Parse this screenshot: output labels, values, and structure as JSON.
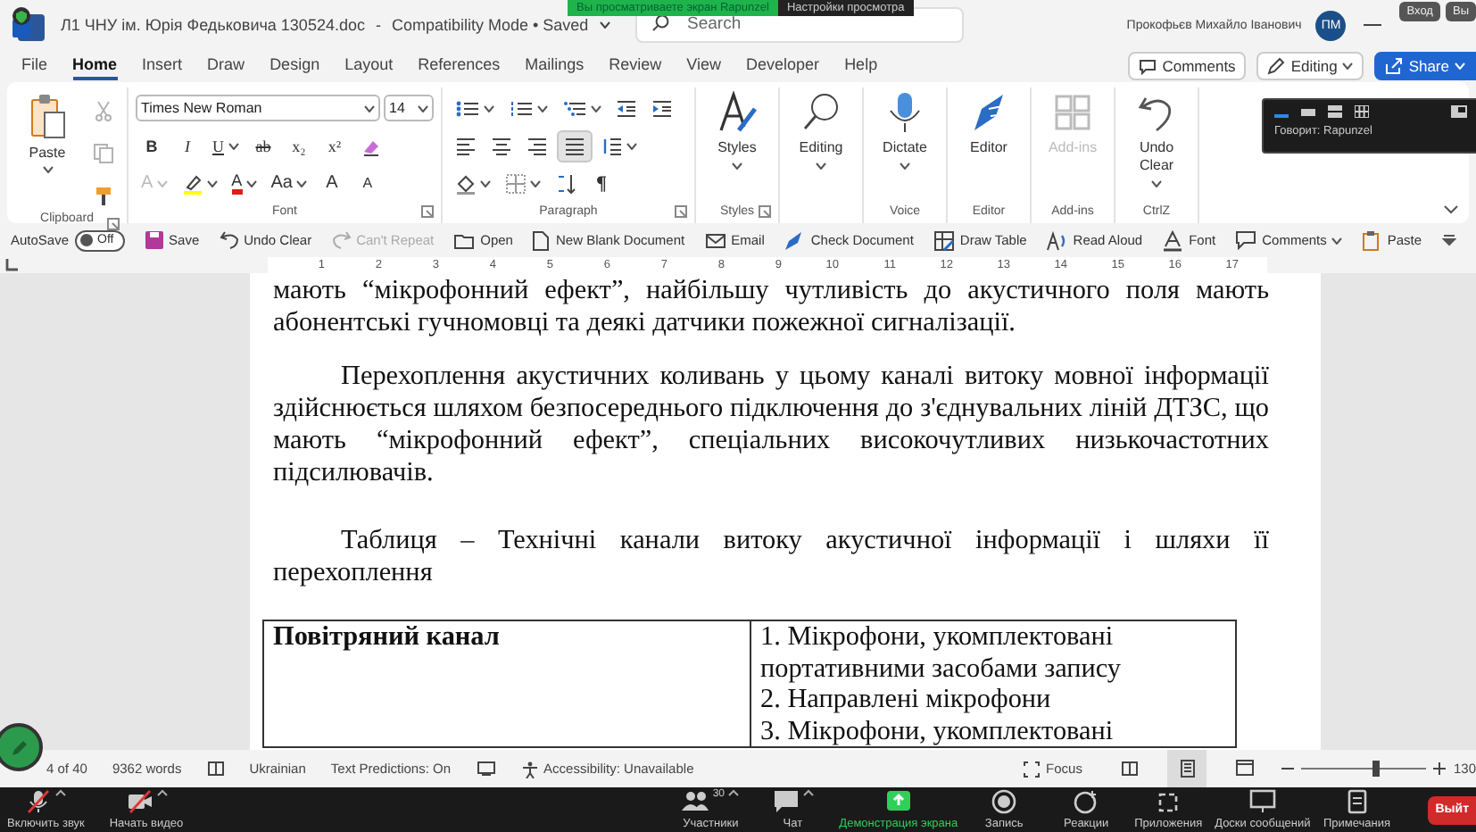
{
  "viewer_banner": {
    "message": "Вы просматриваете экран Rapunzel",
    "settings": "Настройки просмотра"
  },
  "title_bar": {
    "document_title": "Л1 ЧНУ ім. Юрія Федьковича 130524.doc",
    "separator": "-",
    "mode": "Compatibility Mode • Saved",
    "search": {
      "placeholder": "Search"
    },
    "user_name": "Прокофьєв Михайло Іванович",
    "avatar": "ПМ",
    "window_buttons": [
      "Вход",
      "Вы"
    ]
  },
  "menu_tabs": [
    {
      "label": "File",
      "selected": false
    },
    {
      "label": "Home",
      "selected": true
    },
    {
      "label": "Insert",
      "selected": false
    },
    {
      "label": "Draw",
      "selected": false
    },
    {
      "label": "Design",
      "selected": false
    },
    {
      "label": "Layout",
      "selected": false
    },
    {
      "label": "References",
      "selected": false
    },
    {
      "label": "Mailings",
      "selected": false
    },
    {
      "label": "Review",
      "selected": false
    },
    {
      "label": "View",
      "selected": false
    },
    {
      "label": "Developer",
      "selected": false
    },
    {
      "label": "Help",
      "selected": false
    }
  ],
  "header_buttons": [
    {
      "kind": "comments",
      "label": "Comments"
    },
    {
      "kind": "editing",
      "label": "Editing"
    },
    {
      "kind": "share",
      "label": "Share"
    }
  ],
  "ribbon": {
    "groups": [
      {
        "kind": "clipboard",
        "label": "Clipboard",
        "paste": "Paste",
        "tools": [
          {
            "kind": "cut",
            "disabled": true
          },
          {
            "kind": "copy",
            "disabled": true
          },
          {
            "kind": "painter",
            "disabled": false
          }
        ]
      },
      {
        "kind": "font",
        "label": "Font",
        "font_name": "Times New Roman",
        "font_size": "14",
        "rows": [
          {
            "buttons": [
              {
                "kind": "bold",
                "label": "B",
                "disabled": false
              },
              {
                "kind": "italic",
                "label": "I",
                "disabled": false
              },
              {
                "kind": "underline",
                "label": "U",
                "dropdown": true,
                "disabled": false
              },
              {
                "kind": "strike",
                "label": "ab",
                "disabled": false
              },
              {
                "kind": "subscript",
                "label": "x₂",
                "disabled": false
              },
              {
                "kind": "superscript",
                "label": "x²",
                "disabled": false
              },
              {
                "kind": "clear",
                "disabled": false
              }
            ]
          },
          {
            "buttons": [
              {
                "kind": "effects",
                "label": "A",
                "dropdown": true,
                "disabled": true
              },
              {
                "kind": "highlight",
                "dropdown": true,
                "disabled": false
              },
              {
                "kind": "color",
                "label": "A",
                "dropdown": true,
                "disabled": false
              },
              {
                "kind": "case",
                "label": "Aa",
                "dropdown": true,
                "disabled": false
              },
              {
                "kind": "grow",
                "label": "A",
                "disabled": false
              },
              {
                "kind": "shrink",
                "label": "A",
                "disabled": false
              }
            ]
          }
        ]
      },
      {
        "kind": "paragraph",
        "label": "Paragraph",
        "rows": [
          {
            "buttons": [
              {
                "kind": "bullets",
                "dropdown": true,
                "selected": false
              },
              {
                "kind": "numbering",
                "dropdown": true,
                "selected": false
              },
              {
                "kind": "multilevel",
                "dropdown": true,
                "selected": false
              },
              {
                "kind": "outdent",
                "selected": false
              },
              {
                "kind": "indent",
                "selected": false
              }
            ]
          },
          {
            "buttons": [
              {
                "kind": "left",
                "selected": false
              },
              {
                "kind": "center",
                "selected": false
              },
              {
                "kind": "right",
                "selected": false
              },
              {
                "kind": "justify",
                "selected": true
              },
              {
                "kind": "spacing",
                "dropdown": true,
                "selected": false
              }
            ]
          },
          {
            "buttons": [
              {
                "kind": "shading",
                "dropdown": true,
                "selected": false
              },
              {
                "kind": "borders",
                "dropdown": true,
                "selected": false
              },
              {
                "kind": "sort",
                "selected": false
              },
              {
                "kind": "pilcrow",
                "label": "¶",
                "selected": false
              }
            ]
          }
        ]
      },
      {
        "kind": "large",
        "label": "Styles",
        "buttons": [
          {
            "kind": "styles",
            "label": "Styles",
            "dropdown": true,
            "disabled": false
          }
        ]
      },
      {
        "kind": "large",
        "buttons": [
          {
            "kind": "editing",
            "label": "Editing",
            "dropdown": true,
            "disabled": false
          }
        ]
      },
      {
        "kind": "large",
        "label": "Voice",
        "buttons": [
          {
            "kind": "dictate",
            "label": "Dictate",
            "dropdown": true,
            "disabled": false
          }
        ]
      },
      {
        "kind": "large",
        "label": "Editor",
        "buttons": [
          {
            "kind": "editor",
            "label": "Editor",
            "disabled": false
          }
        ]
      },
      {
        "kind": "large",
        "label": "Add-ins",
        "buttons": [
          {
            "kind": "addins",
            "label": "Add-ins",
            "disabled": true
          }
        ]
      },
      {
        "kind": "large",
        "label": "CtrlZ",
        "buttons": [
          {
            "kind": "undo",
            "label": "Undo Clear",
            "dropdown": true,
            "disabled": false
          }
        ]
      }
    ]
  },
  "speaker_panel": {
    "text": "Говорит: Rapunzel"
  },
  "quick_access": {
    "autosave_label": "AutoSave",
    "autosave": {
      "on": false,
      "label": "Off"
    },
    "commands": [
      {
        "kind": "save",
        "label": "Save",
        "disabled": false
      },
      {
        "kind": "undo",
        "label": "Undo Clear",
        "disabled": false
      },
      {
        "kind": "redo",
        "label": "Can't Repeat",
        "disabled": true
      },
      {
        "kind": "open",
        "label": "Open",
        "disabled": false
      },
      {
        "kind": "new",
        "label": "New Blank Document",
        "disabled": false
      },
      {
        "kind": "email",
        "label": "Email",
        "disabled": false
      },
      {
        "kind": "check",
        "label": "Check Document",
        "disabled": false
      },
      {
        "kind": "table",
        "label": "Draw Table",
        "disabled": false
      },
      {
        "kind": "read",
        "label": "Read Aloud",
        "disabled": false
      },
      {
        "kind": "font",
        "label": "Font",
        "disabled": false
      },
      {
        "kind": "comments",
        "label": "Comments",
        "dropdown": true,
        "disabled": false
      },
      {
        "kind": "paste",
        "label": "Paste",
        "disabled": false
      }
    ]
  },
  "ruler": {
    "marks": [
      "1",
      "2",
      "3",
      "4",
      "5",
      "6",
      "7",
      "8",
      "9",
      "10",
      "11",
      "12",
      "13",
      "14",
      "15",
      "16",
      "17"
    ]
  },
  "document": {
    "paragraphs": [
      {
        "text": "мають “мікрофонний ефект”, найбільшу чутливість до акустичного поля мають абонентські гучномовці та деякі датчики пожежної сигналізації.",
        "indent": false
      },
      {
        "text": "Перехоплення акустичних коливань у цьому каналі витоку мовної інформації здійснюється шляхом безпосереднього підключення до з'єднувальних ліній ДТЗС, що мають “мікрофонний ефект”, спеціальних високочутливих низькочастотних підсилювачів.",
        "indent": true
      },
      {
        "text": "Таблиця – Технічні канали витоку акустичної інформації і шляхи її перехоплення",
        "indent": true
      }
    ],
    "table": {
      "rows": [
        {
          "channel": "Повітряний канал",
          "methods": [
            "1. Мікрофони, укомплектовані портативними засобами запису",
            "2. Направлені мікрофони",
            "3. Мікрофони, укомплектовані"
          ]
        }
      ]
    }
  },
  "status_bar": {
    "page": "4 of 40",
    "words": "9362 words",
    "language": "Ukrainian",
    "predictions": "Text Predictions: On",
    "accessibility": "Accessibility: Unavailable",
    "focus": "Focus",
    "views": [
      {
        "kind": "read",
        "selected": false
      },
      {
        "kind": "print",
        "selected": true
      },
      {
        "kind": "web",
        "selected": false
      }
    ],
    "zoom": {
      "level": 0.6,
      "reading": "130"
    }
  },
  "meeting_toolbar": {
    "left": [
      {
        "kind": "mic",
        "label": "Включить звук",
        "off": true
      },
      {
        "kind": "video",
        "label": "Начать видео",
        "off": true
      }
    ],
    "center": [
      {
        "kind": "participants",
        "label": "Участники",
        "count": "30",
        "active": false
      },
      {
        "kind": "chat",
        "label": "Чат",
        "active": false
      },
      {
        "kind": "share",
        "label": "Демонстрация экрана",
        "active": true
      },
      {
        "kind": "record",
        "label": "Запись",
        "active": false
      },
      {
        "kind": "reactions",
        "label": "Реакции",
        "active": false
      },
      {
        "kind": "apps",
        "label": "Приложения",
        "active": false
      },
      {
        "kind": "whiteboard",
        "label": "Доски сообщений",
        "active": false
      },
      {
        "kind": "notes",
        "label": "Примечания",
        "active": false
      }
    ],
    "leave": "Выйт"
  }
}
